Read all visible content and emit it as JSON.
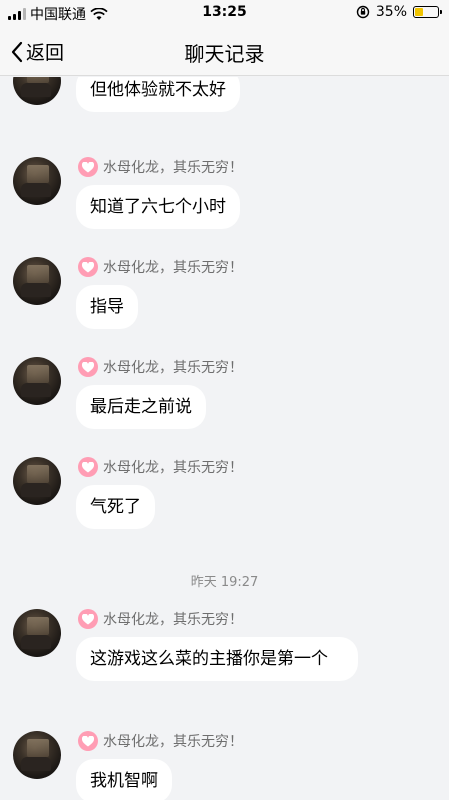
{
  "status_bar": {
    "carrier": "中国联通",
    "time": "13:25",
    "battery_percent": "35%",
    "battery_level": 0.35,
    "icons": [
      "signal-icon",
      "wifi-icon",
      "orientation-lock-icon",
      "battery-icon"
    ]
  },
  "nav": {
    "back_label": "返回",
    "title": "聊天记录"
  },
  "messages": [
    {
      "sender": "",
      "text": "但他体验就不太好"
    },
    {
      "sender": "水母化龙，其乐无穷！",
      "text": "知道了六七个小时"
    },
    {
      "sender": "水母化龙，其乐无穷！",
      "text": "指导"
    },
    {
      "sender": "水母化龙，其乐无穷！",
      "text": "最后走之前说"
    },
    {
      "sender": "水母化龙，其乐无穷！",
      "text": "气死了"
    },
    {
      "sender": "水母化龙，其乐无穷！",
      "text": "这游戏这么菜的主播你是第一个"
    },
    {
      "sender": "水母化龙，其乐无穷！",
      "text": "我机智啊"
    }
  ],
  "time_divider": "昨天 19:27",
  "colors": {
    "background": "#f2f3f5",
    "bubble": "#ffffff",
    "badge": "#ff9db4",
    "battery_fill": "#f0c400"
  }
}
